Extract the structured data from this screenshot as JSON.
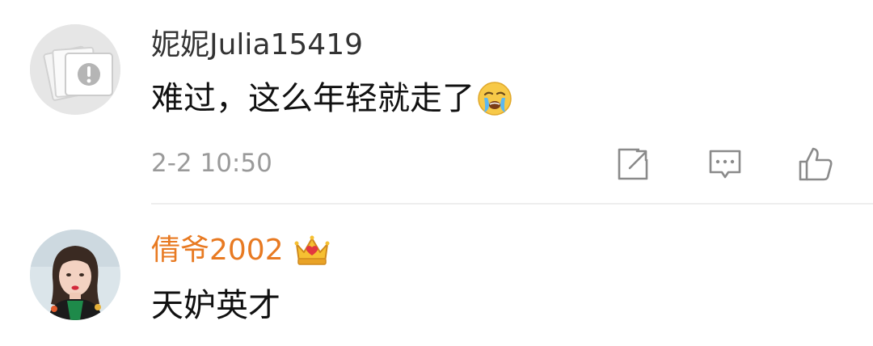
{
  "comments": [
    {
      "username": "妮妮Julia15419",
      "text": "难过，这么年轻就走了",
      "emoji": "crying-face",
      "time": "2-2 10:50",
      "actions": [
        "share-icon",
        "reply-icon",
        "like-icon"
      ]
    },
    {
      "username": "倩爷2002",
      "badge": "crown-icon",
      "text": "天妒英才"
    }
  ],
  "colors": {
    "username_default": "#333333",
    "username_vip": "#e87a22",
    "text": "#111111",
    "meta": "#9a9a9a",
    "divider": "#eeeeee"
  }
}
